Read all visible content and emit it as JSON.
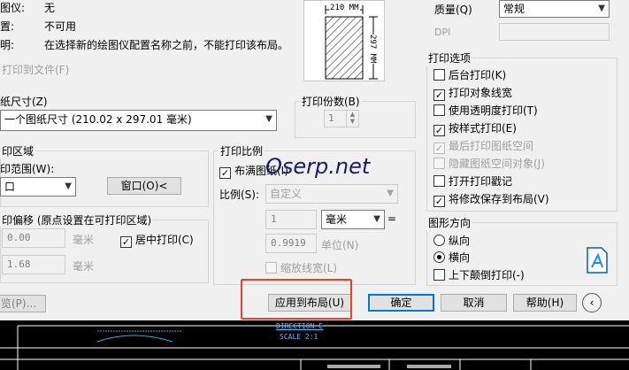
{
  "info": {
    "plotter_label": "图仪:",
    "plotter_value": "无",
    "where_label": "置:",
    "where_value": "不可用",
    "desc_label": "明:",
    "desc_value": "在选择新的绘图仪配置名称之前，不能打印该布局。",
    "plot_to_file": "打印到文件(F)"
  },
  "preview": {
    "width_label": "210 MM",
    "height_label": "297 MM"
  },
  "paper_size": {
    "title": "纸尺寸(Z)",
    "value": "一个图纸尺寸 (210.02 x 297.01 毫米)"
  },
  "copies": {
    "title": "打印份数(B)",
    "value": "1"
  },
  "plot_area": {
    "title": "印区域",
    "range_label": "印范围(W):",
    "range_value": "口",
    "window_button": "窗口(O)<"
  },
  "plot_offset": {
    "title": "印偏移 (原点设置在可打印区域)",
    "x_value": "0.00",
    "x_unit": "毫米",
    "y_value": "1.68",
    "y_unit": "毫米",
    "center_label": "居中打印(C)"
  },
  "plot_scale": {
    "title": "打印比例",
    "fit_label": "布满图纸(I)",
    "scale_label": "比例(S):",
    "scale_value": "自定义",
    "val1": "1",
    "unit_value": "毫米",
    "equals": "=",
    "val2": "0.9919",
    "unit_label": "单位(N)",
    "scale_lw": "缩放线宽(L)"
  },
  "quality": {
    "label": "质量(Q)",
    "value": "常规",
    "dpi_label": "DPI"
  },
  "plot_options": {
    "title": "打印选项",
    "items": [
      {
        "label": "后台打印(K)",
        "checked": "",
        "disabled": false
      },
      {
        "label": "打印对象线宽",
        "checked": "✓",
        "disabled": false
      },
      {
        "label": "使用透明度打印(T)",
        "checked": "",
        "disabled": false
      },
      {
        "label": "按样式打印(E)",
        "checked": "✓",
        "disabled": false
      },
      {
        "label": "最后打印图纸空间",
        "checked": "✓",
        "disabled": true
      },
      {
        "label": "隐藏图纸空间对象(J)",
        "checked": "",
        "disabled": true
      },
      {
        "label": "打开打印戳记",
        "checked": "",
        "disabled": false
      },
      {
        "label": "将修改保存到布局(V)",
        "checked": "✓",
        "disabled": false
      }
    ]
  },
  "orientation": {
    "title": "图形方向",
    "portrait": "纵向",
    "landscape": "横向",
    "upside_down": "上下颠倒打印(-)"
  },
  "buttons": {
    "preview": "览(P)...",
    "apply": "应用到布局(U)",
    "ok": "确定",
    "cancel": "取消",
    "help": "帮助(H)"
  },
  "watermark": "Oserp.net",
  "drawing": {
    "title": "DIRECTION E",
    "scale": "SCALE 2:1"
  },
  "colors": {
    "highlight": "#e8402a",
    "accent": "#0078d7"
  }
}
